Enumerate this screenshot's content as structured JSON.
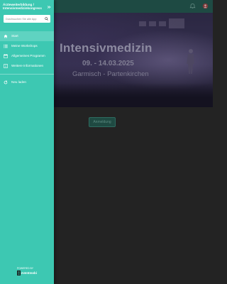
{
  "drawer": {
    "app_title": "Ärzteweiterbildung / Intensivmedizinkongress",
    "search": {
      "placeholder": "Durchsuchen Sie alle App",
      "value": ""
    },
    "items": [
      {
        "label": "Start",
        "icon": "home-icon",
        "active": true
      },
      {
        "label": "Meine Workshops",
        "icon": "list-icon",
        "active": false
      },
      {
        "label": "Allgemeines Programm",
        "icon": "calendar-icon",
        "active": false
      },
      {
        "label": "Weitere Informationen",
        "icon": "info-icon",
        "active": false
      },
      {
        "label": "Neu laden",
        "icon": "refresh-icon",
        "active": false
      }
    ],
    "powered_by": "POWERED BY",
    "brand": "eventmobi"
  },
  "hero": {
    "title": "Intensivmedizin",
    "dates": "09. - 14.03.2025",
    "location": "Garmisch - Partenkirchen"
  },
  "main": {
    "register_label": "Anmeldung"
  },
  "colors": {
    "accent": "#3dc8b2",
    "active_item": "#5fd3c1",
    "topbar": "#1e4a43",
    "background": "#232323"
  }
}
